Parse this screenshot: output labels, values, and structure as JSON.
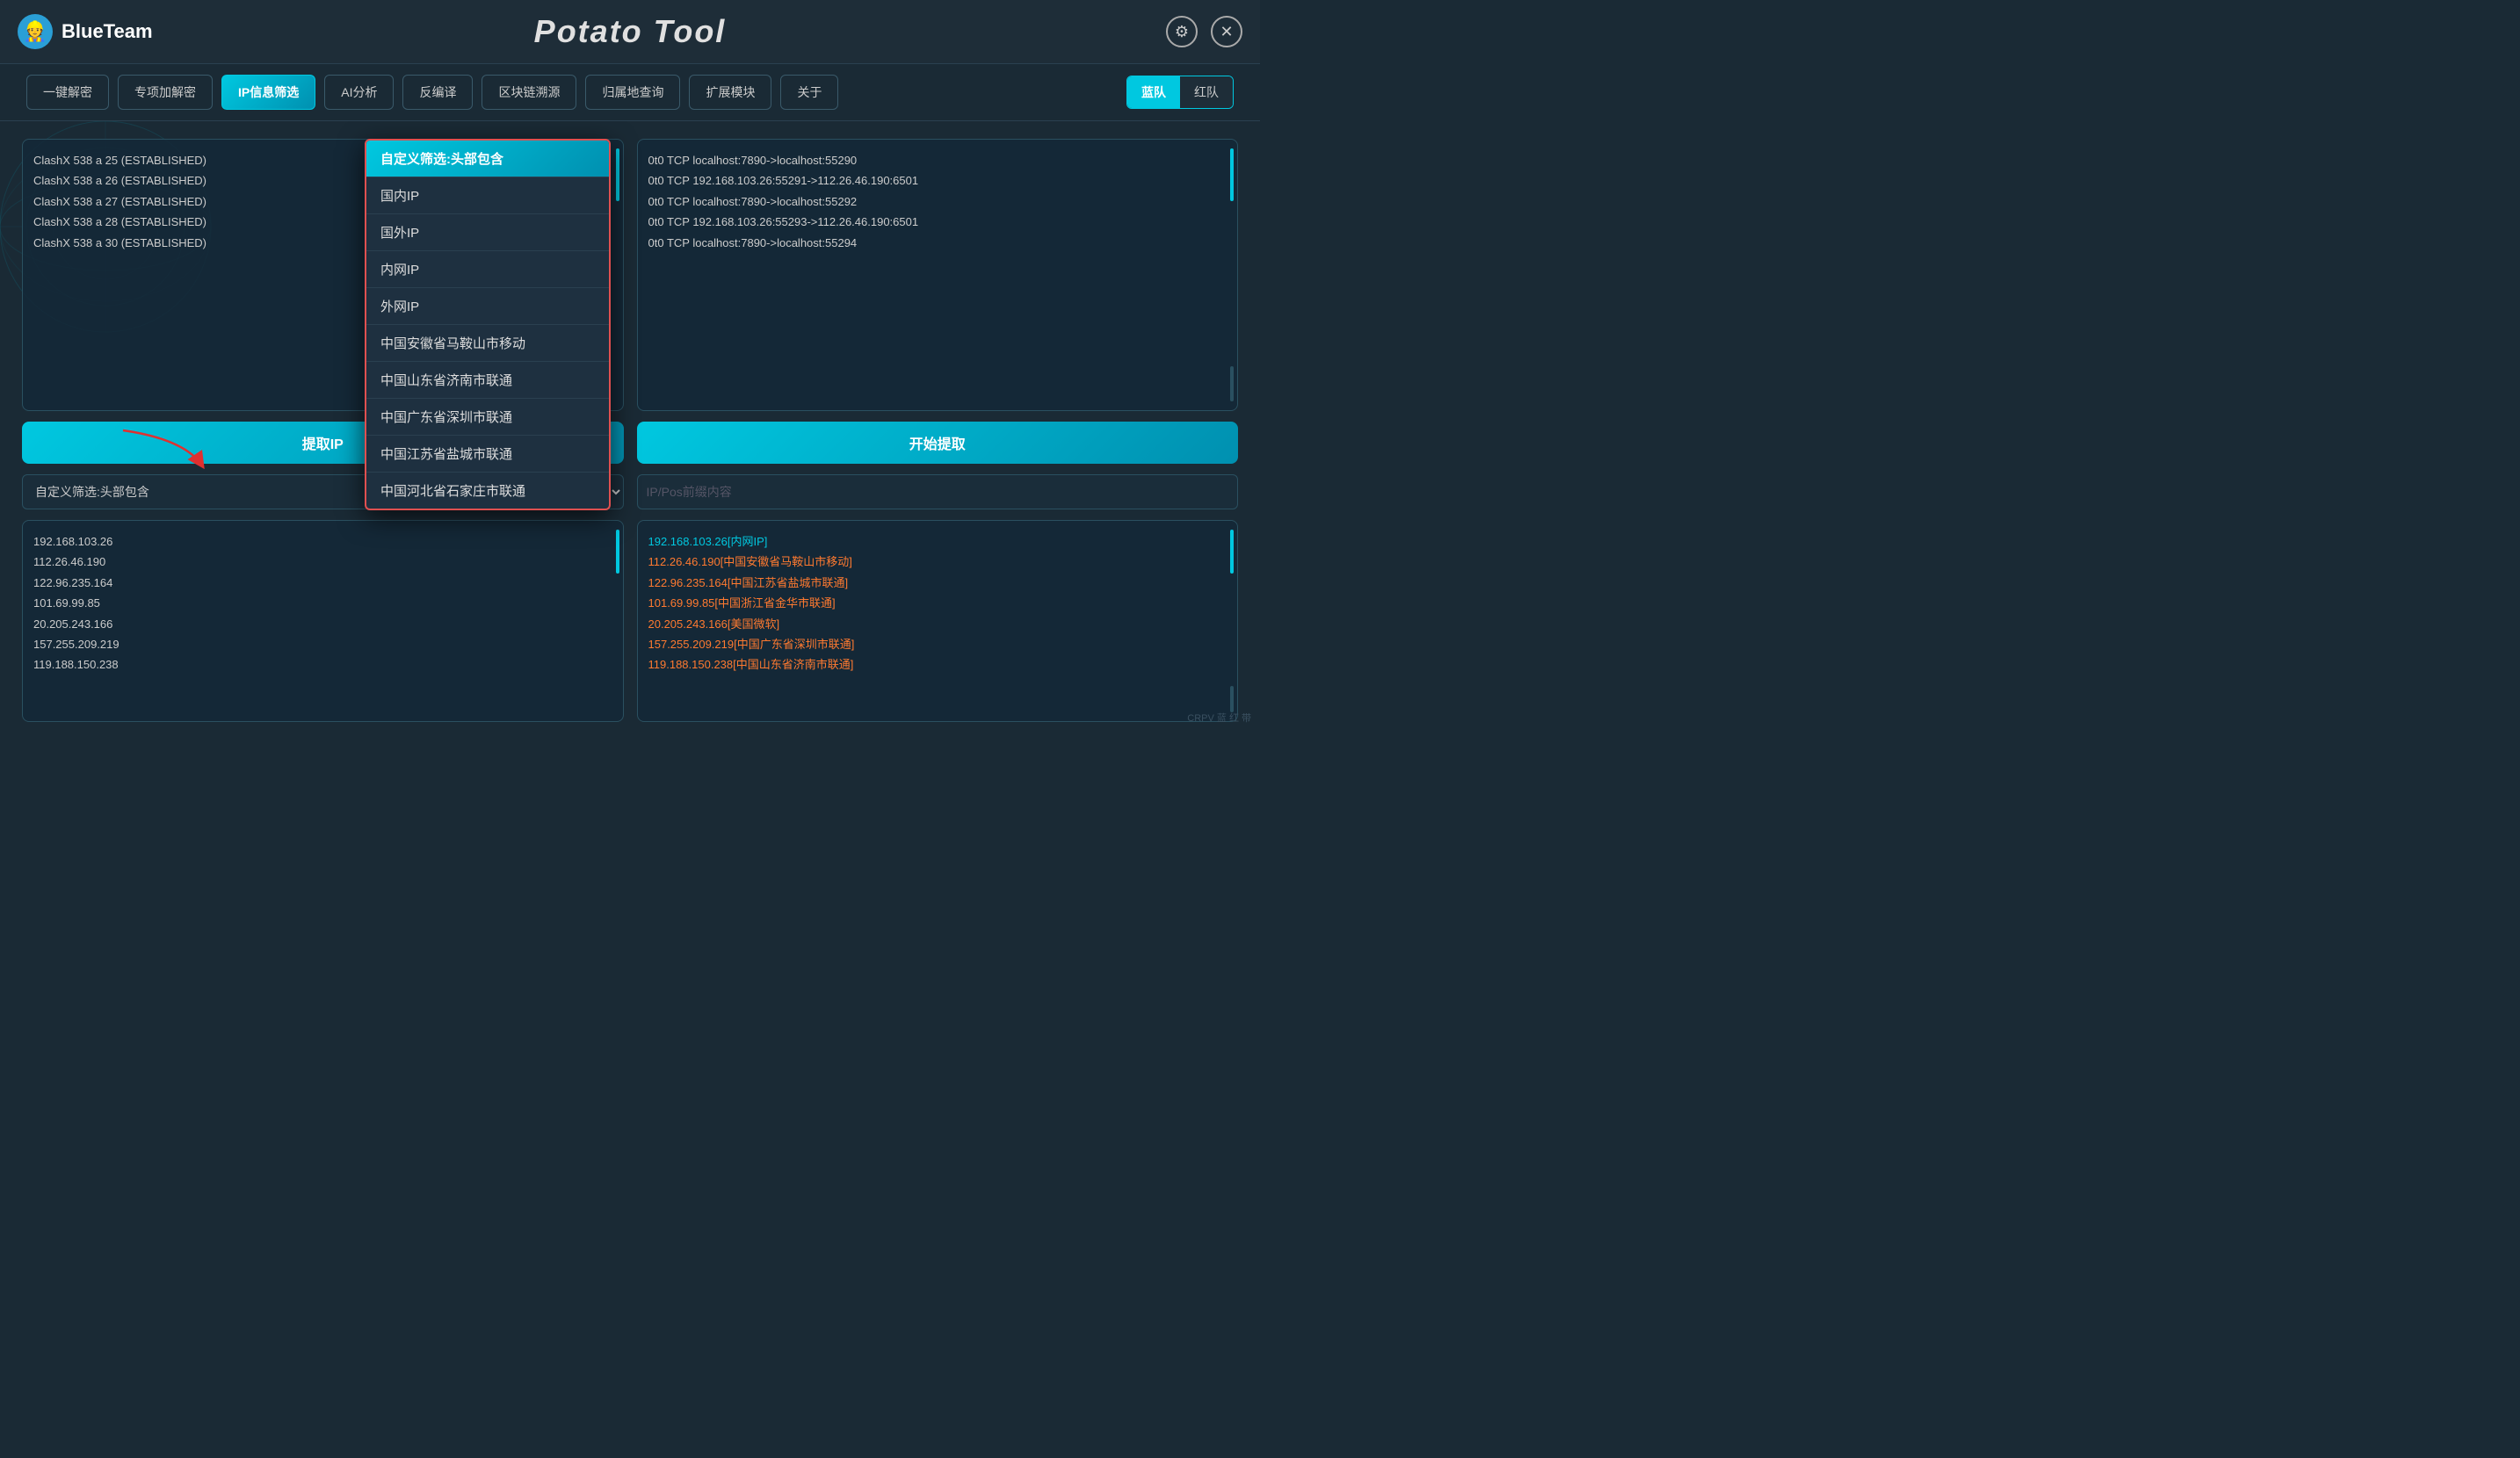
{
  "app": {
    "title": "Potato Tool",
    "brand": "BlueTeam",
    "avatar_char": "👷"
  },
  "titlebar": {
    "settings_icon": "⚙",
    "close_icon": "✕"
  },
  "navbar": {
    "buttons": [
      {
        "label": "一键解密",
        "active": false
      },
      {
        "label": "专项加解密",
        "active": false
      },
      {
        "label": "IP信息筛选",
        "active": true
      },
      {
        "label": "AI分析",
        "active": false
      },
      {
        "label": "反编译",
        "active": false
      },
      {
        "label": "区块链溯源",
        "active": false
      },
      {
        "label": "归属地查询",
        "active": false
      },
      {
        "label": "扩展模块",
        "active": false
      },
      {
        "label": "关于",
        "active": false
      }
    ],
    "team_blue": "蓝队",
    "team_red": "红队"
  },
  "upper_left_lines": [
    "ClashX  538  a 25 (ESTABLISHED)",
    "ClashX  538  a 26 (ESTABLISHED)",
    "ClashX  538  a 27 (ESTABLISHED)",
    "ClashX  538  a 28 (ESTABLISHED)",
    "ClashX  538  a 30 (ESTABLISHED)"
  ],
  "upper_right_lines": [
    "0t0  TCP localhost:7890->localhost:55290",
    "0t0  TCP 192.168.103.26:55291->112.26.46.190:6501",
    "0t0  TCP localhost:7890->localhost:55292",
    "0t0  TCP 192.168.103.26:55293->112.26.46.190:6501",
    "0t0  TCP localhost:7890->localhost:55294"
  ],
  "dropdown": {
    "items": [
      "自定义筛选:头部包含",
      "国内IP",
      "国外IP",
      "内网IP",
      "外网IP",
      "中国安徽省马鞍山市移动",
      "中国山东省济南市联通",
      "中国广东省深圳市联通",
      "中国江苏省盐城市联通",
      "中国河北省石家庄市联通"
    ]
  },
  "buttons": {
    "extract": "提取IP",
    "start": "开始提取"
  },
  "filter": {
    "select_value": "自定义筛选:头部包含",
    "input_placeholder": "IP/Pos前缀内容",
    "select_options": [
      "自定义筛选:头部包含",
      "国内IP",
      "国外IP",
      "内网IP",
      "外网IP"
    ]
  },
  "lower_left_ips": [
    "192.168.103.26",
    "112.26.46.190",
    "122.96.235.164",
    "101.69.99.85",
    "20.205.243.166",
    "157.255.209.219",
    "119.188.150.238"
  ],
  "lower_right_results": [
    {
      "text": "192.168.103.26[内网IP]",
      "type": "local"
    },
    {
      "text": "112.26.46.190[中国安徽省马鞍山市移动]",
      "type": "cn"
    },
    {
      "text": "122.96.235.164[中国江苏省盐城市联通]",
      "type": "cn"
    },
    {
      "text": "101.69.99.85[中国浙江省金华市联通]",
      "type": "cn"
    },
    {
      "text": "20.205.243.166[美国微软]",
      "type": "cn"
    },
    {
      "text": "157.255.209.219[中国广东省深圳市联通]",
      "type": "cn"
    },
    {
      "text": "119.188.150.238[中国山东省济南市联通]",
      "type": "cn"
    }
  ],
  "watermark": "CRPV 蓝 红 带"
}
